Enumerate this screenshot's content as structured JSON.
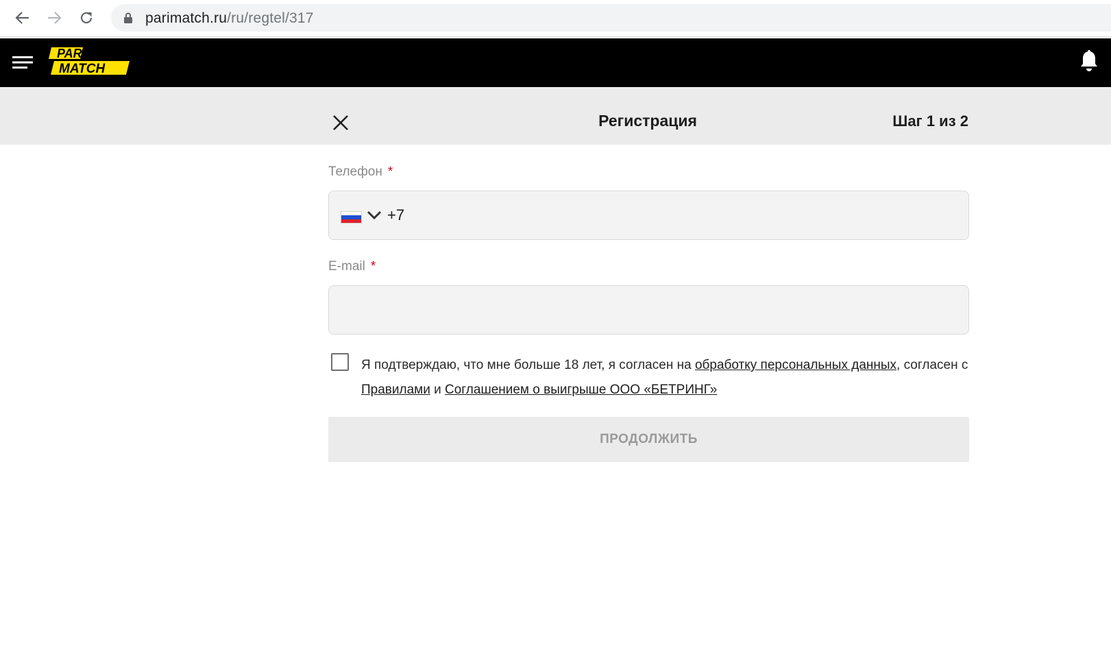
{
  "browser": {
    "url_host": "parimatch.ru",
    "url_path": "/ru/regtel/317"
  },
  "header": {
    "logo_text": "PARI MATCH",
    "brand_color": "#ffe100"
  },
  "registration": {
    "title": "Регистрация",
    "step": "Шаг 1 из 2"
  },
  "form": {
    "phone": {
      "label": "Телефон",
      "required_mark": "*",
      "country": "ru-flag-icon",
      "prefix": "+7"
    },
    "email": {
      "label": "E-mail",
      "required_mark": "*",
      "value": ""
    },
    "consent": {
      "checked": false,
      "text_1": "Я подтверждаю, что мне больше 18 лет, я согласен на ",
      "link_1": "обработку персональных данных",
      "text_2": ", согласен с ",
      "link_2": "Правилами",
      "text_3": " и ",
      "link_3": "Соглашением о выигрыше ООО «БЕТРИНГ»"
    },
    "continue_label": "ПРОДОЛЖИТЬ"
  }
}
